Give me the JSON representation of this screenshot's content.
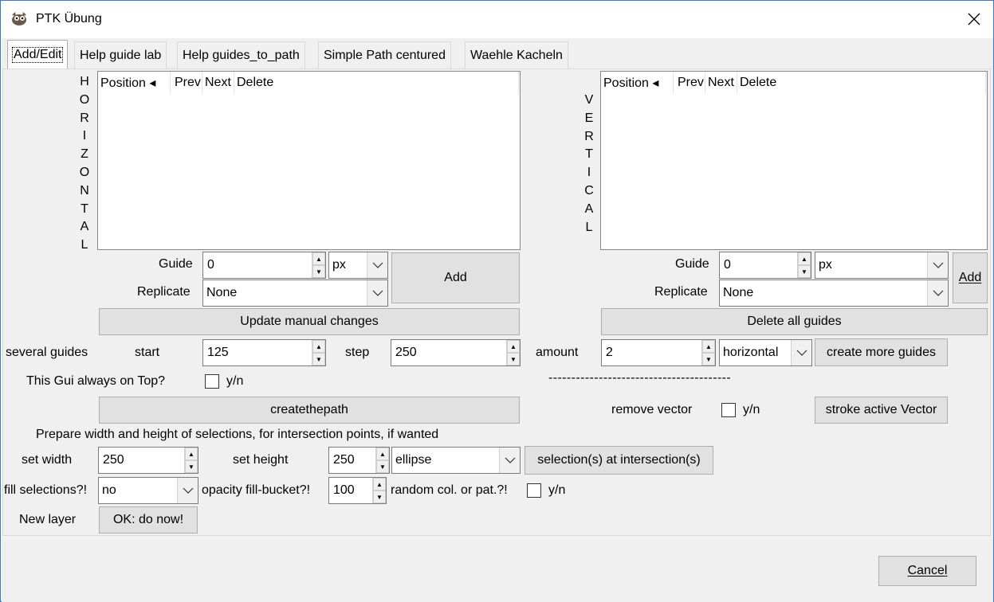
{
  "window": {
    "title": "PTK Übung",
    "icons": {
      "app": "gimp-icon",
      "close": "close-icon"
    }
  },
  "tabs": [
    {
      "label": "Add/Edit",
      "active": true
    },
    {
      "label": "Help guide lab",
      "active": false
    },
    {
      "label": "Help guides_to_path",
      "active": false
    },
    {
      "label": "Simple Path centured",
      "active": false
    },
    {
      "label": "Waehle Kacheln",
      "active": false
    }
  ],
  "horizontal": {
    "vertical_label": [
      "H",
      "O",
      "R",
      "I",
      "Z",
      "O",
      "N",
      "T",
      "A",
      "L"
    ],
    "columns": [
      "Position ◂",
      "Prev",
      "Next",
      "Delete"
    ],
    "guide_label": "Guide",
    "guide_value": "0",
    "unit": "px",
    "replicate_label": "Replicate",
    "replicate_value": "None",
    "add_button": "Add",
    "update_button": "Update manual changes"
  },
  "vertical": {
    "vertical_label": [
      "V",
      "E",
      "R",
      "T",
      "I",
      "C",
      "A",
      "L"
    ],
    "columns": [
      "Position ◂",
      "Prev",
      "Next",
      "Delete"
    ],
    "guide_label": "Guide",
    "guide_value": "0",
    "unit": "px",
    "replicate_label": "Replicate",
    "replicate_value": "None",
    "add_button": "Add",
    "delete_all_button": "Delete all guides"
  },
  "several": {
    "label": "several guides",
    "start_label": "start",
    "start_value": "125",
    "step_label": "step",
    "step_value": "250",
    "amount_label": "amount",
    "amount_value": "2",
    "orientation_value": "horizontal",
    "create_button": "create more guides"
  },
  "on_top": {
    "label": "This Gui always on Top?",
    "checkbox_label": "y/n",
    "checked": false
  },
  "separator_text": "----------------------------------------",
  "path": {
    "create_button": "createthepath",
    "remove_label": "remove vector",
    "remove_checkbox_label": "y/n",
    "stroke_button": "stroke active Vector"
  },
  "selections": {
    "heading": "Prepare width and height of selections, for intersection points, if wanted",
    "width_label": "set width",
    "width_value": "250",
    "height_label": "set height",
    "height_value": "250",
    "shape_value": "ellipse",
    "intersection_button": "selection(s) at intersection(s)",
    "fill_label": "fill selections?!",
    "fill_value": "no",
    "opacity_label": "opacity fill-bucket?!",
    "opacity_value": "100",
    "random_label": "random col. or pat.?!",
    "random_checkbox_label": "y/n",
    "new_layer_label": "New layer",
    "ok_button": "OK: do now!"
  },
  "footer": {
    "cancel_button": "Cancel"
  }
}
